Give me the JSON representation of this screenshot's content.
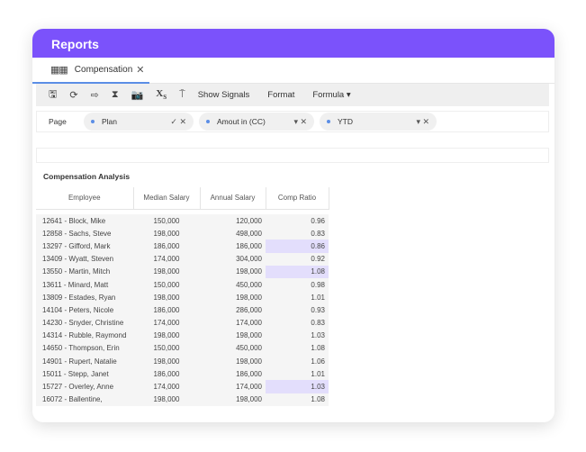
{
  "header": {
    "title": "Reports"
  },
  "tab": {
    "label": "Compensation",
    "close": "✕"
  },
  "toolbar": {
    "show_signals": "Show Signals",
    "format": "Format",
    "formula": "Formula ▾"
  },
  "filters": {
    "page_label": "Page",
    "chips": [
      {
        "label": "Plan",
        "controls": "✓ ✕"
      },
      {
        "label": "Amout in (CC)",
        "controls": "▾ ✕"
      },
      {
        "label": "YTD",
        "controls": "▾ ✕"
      }
    ]
  },
  "report": {
    "title": "Compensation Analysis",
    "columns": [
      "Employee",
      "Median Salary",
      "Annual Salary",
      "Comp Ratio"
    ],
    "rows": [
      [
        "12641 - Block, Mike",
        "150,000",
        "120,000",
        "0.96",
        false
      ],
      [
        "12858 - Sachs, Steve",
        "198,000",
        "498,000",
        "0.83",
        false
      ],
      [
        "13297 - Gifford, Mark",
        "186,000",
        "186,000",
        "0.86",
        true
      ],
      [
        "13409 - Wyatt, Steven",
        "174,000",
        "304,000",
        "0.92",
        false
      ],
      [
        "13550 - Martin, Mitch",
        "198,000",
        "198,000",
        "1.08",
        true
      ],
      [
        "13611 - Minard, Matt",
        "150,000",
        "450,000",
        "0.98",
        false
      ],
      [
        "13809 - Estades, Ryan",
        "198,000",
        "198,000",
        "1.01",
        false
      ],
      [
        "14104 - Peters, Nicole",
        "186,000",
        "286,000",
        "0.93",
        false
      ],
      [
        "14230 - Snyder, Christine",
        "174,000",
        "174,000",
        "0.83",
        false
      ],
      [
        "14314 - Rubble, Raymond",
        "198,000",
        "198,000",
        "1.03",
        false
      ],
      [
        "14650 - Thompson, Erin",
        "150,000",
        "450,000",
        "1.08",
        false
      ],
      [
        "14901 - Rupert, Natalie",
        "198,000",
        "198,000",
        "1.06",
        false
      ],
      [
        "15011 - Stepp, Janet",
        "186,000",
        "186,000",
        "1.01",
        false
      ],
      [
        "15727 - Overley, Anne",
        "174,000",
        "174,000",
        "1.03",
        true
      ],
      [
        "16072 - Ballentine,",
        "198,000",
        "198,000",
        "1.08",
        false
      ]
    ]
  }
}
